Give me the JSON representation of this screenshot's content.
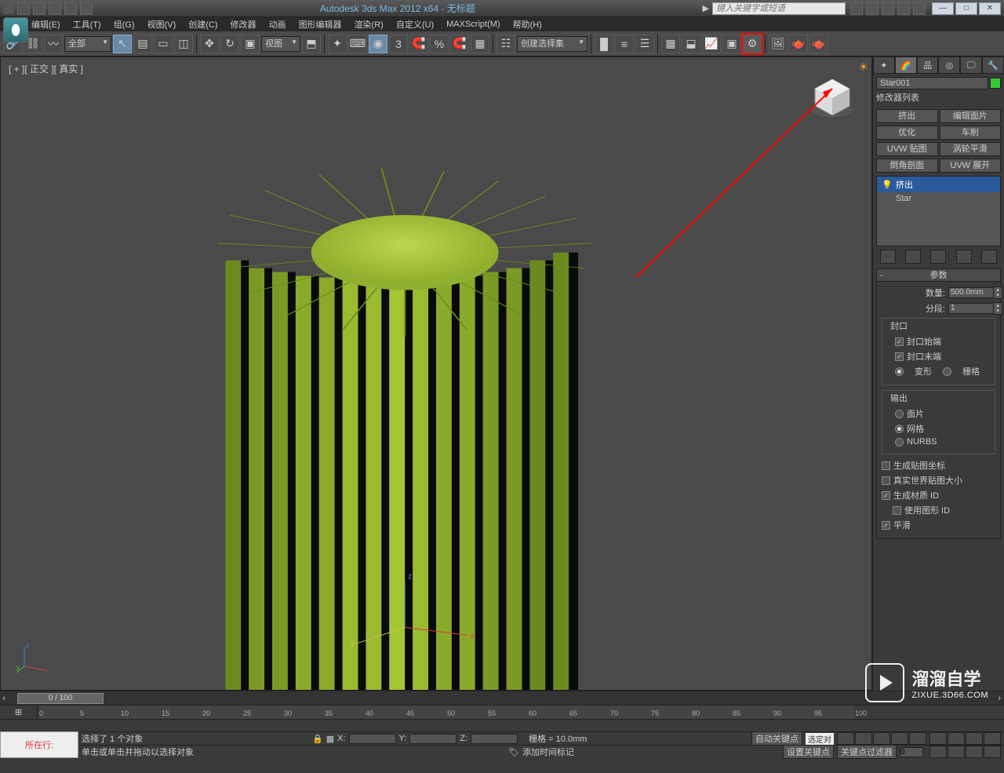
{
  "title": "Autodesk 3ds Max 2012 x64 - 无标题",
  "search_placeholder": "键入关键字或短语",
  "menubar": [
    "编辑(E)",
    "工具(T)",
    "组(G)",
    "视图(V)",
    "创建(C)",
    "修改器",
    "动画",
    "图形编辑器",
    "渲染(R)",
    "自定义(U)",
    "MAXScript(M)",
    "帮助(H)"
  ],
  "toolbar": {
    "filter": "全部",
    "viewmode": "视图",
    "selection_set": "创建选择集"
  },
  "viewport": {
    "label": "[ + ][ 正交 ][ 真实 ]"
  },
  "command_panel": {
    "object_name": "Star001",
    "modifier_list_label": "修改器列表",
    "buttons": [
      "挤出",
      "编辑面片",
      "优化",
      "车削",
      "UVW 贴图",
      "涡轮平滑",
      "倒角剖面",
      "UVW 展开"
    ],
    "stack": [
      "挤出",
      "Star"
    ]
  },
  "parameters": {
    "header": "参数",
    "amount_label": "数量:",
    "amount_value": "500.0mm",
    "segments_label": "分段:",
    "segments_value": "1",
    "cap_group": "封口",
    "cap_start": "封口始端",
    "cap_end": "封口末端",
    "morph": "变形",
    "grid": "栅格",
    "output_group": "输出",
    "out_patch": "面片",
    "out_mesh": "网格",
    "out_nurbs": "NURBS",
    "gen_mapping": "生成贴图坐标",
    "real_world": "真实世界贴图大小",
    "gen_matid": "生成材质 ID",
    "use_shape": "使用图形 ID",
    "smooth": "平滑"
  },
  "status": {
    "frame": "0 / 100",
    "selection": "选择了 1 个对象",
    "hint": "单击或单击并拖动以选择对象",
    "x_label": "X:",
    "y_label": "Y:",
    "z_label": "Z:",
    "grid": "栅格 = 10.0mm",
    "add_timetag": "添加时间标记",
    "autokey": "自动关键点",
    "selected": "选定对",
    "setkey": "设置关键点",
    "keyfilter": "关键点过滤器",
    "prompt": "所在行:"
  },
  "ticks": [
    "0",
    "5",
    "10",
    "15",
    "20",
    "25",
    "30",
    "35",
    "40",
    "45",
    "50",
    "55",
    "60",
    "65",
    "70",
    "75",
    "80",
    "85",
    "90",
    "95",
    "100"
  ],
  "watermark": {
    "cn": "溜溜自学",
    "en": "ZIXUE.3D66.COM"
  }
}
